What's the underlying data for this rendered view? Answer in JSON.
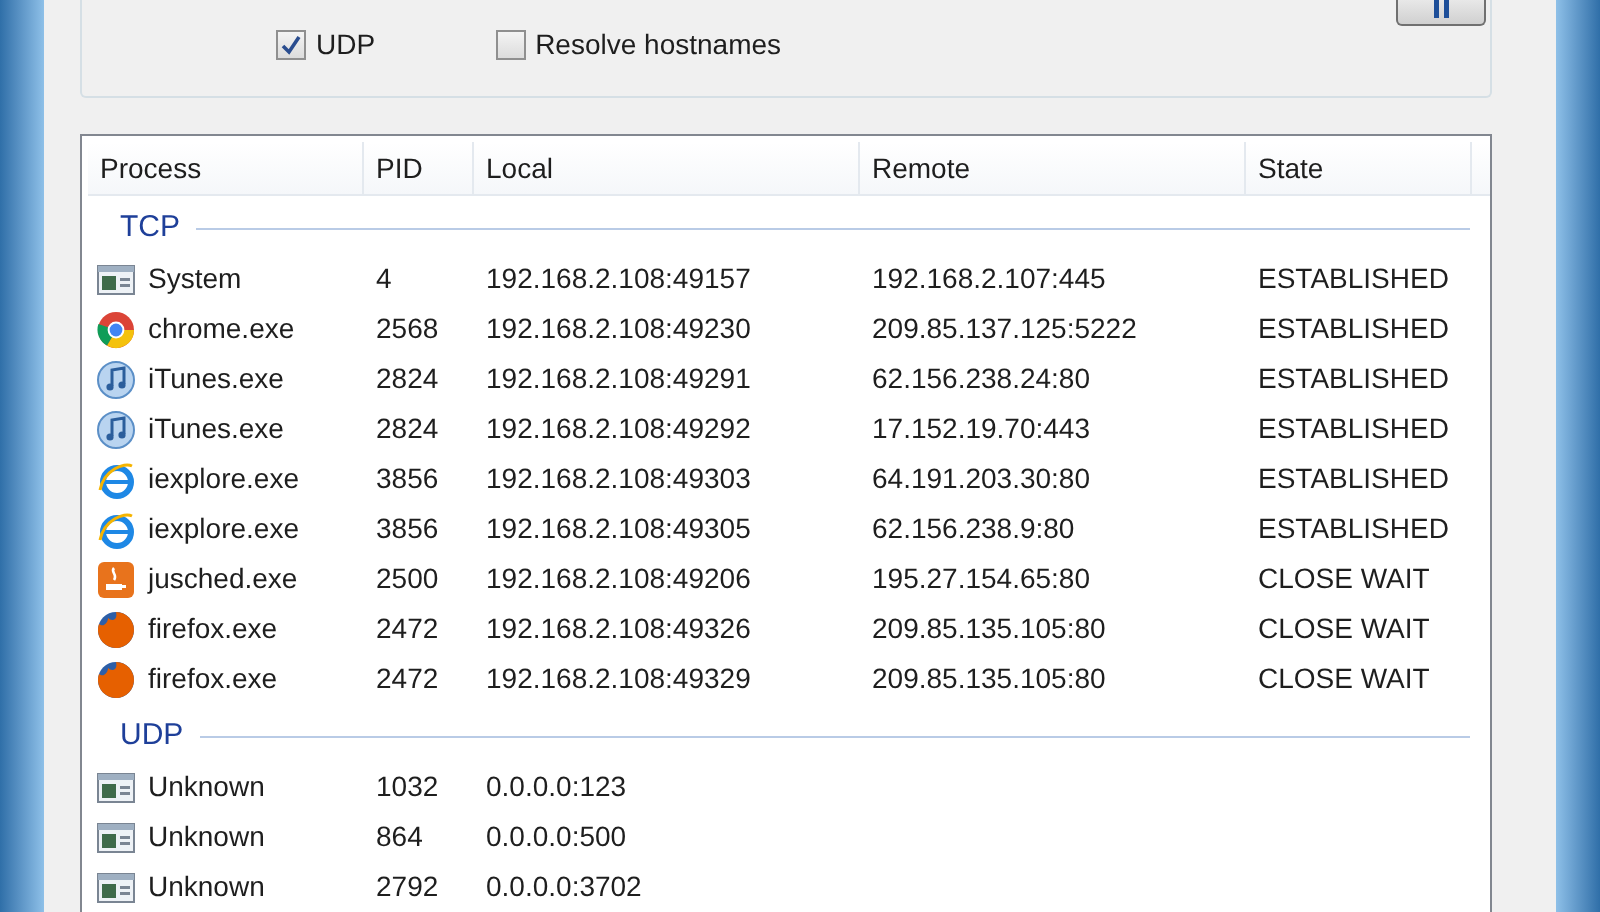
{
  "options": [
    {
      "label": "UDP",
      "checked": true
    },
    {
      "label": "Resolve hostnames",
      "checked": false
    }
  ],
  "table": {
    "columns": [
      "Process",
      "PID",
      "Local",
      "Remote",
      "State"
    ],
    "groups": [
      {
        "name": "TCP",
        "rows": [
          {
            "kind": "app",
            "process": "System",
            "pid": "4",
            "local": "192.168.2.108:49157",
            "remote": "192.168.2.107:445",
            "state": "ESTABLISHED"
          },
          {
            "kind": "chrome",
            "process": "chrome.exe",
            "pid": "2568",
            "local": "192.168.2.108:49230",
            "remote": "209.85.137.125:5222",
            "state": "ESTABLISHED"
          },
          {
            "kind": "itunes",
            "process": "iTunes.exe",
            "pid": "2824",
            "local": "192.168.2.108:49291",
            "remote": "62.156.238.24:80",
            "state": "ESTABLISHED"
          },
          {
            "kind": "itunes",
            "process": "iTunes.exe",
            "pid": "2824",
            "local": "192.168.2.108:49292",
            "remote": "17.152.19.70:443",
            "state": "ESTABLISHED"
          },
          {
            "kind": "ie",
            "process": "iexplore.exe",
            "pid": "3856",
            "local": "192.168.2.108:49303",
            "remote": "64.191.203.30:80",
            "state": "ESTABLISHED"
          },
          {
            "kind": "ie",
            "process": "iexplore.exe",
            "pid": "3856",
            "local": "192.168.2.108:49305",
            "remote": "62.156.238.9:80",
            "state": "ESTABLISHED"
          },
          {
            "kind": "java",
            "process": "jusched.exe",
            "pid": "2500",
            "local": "192.168.2.108:49206",
            "remote": "195.27.154.65:80",
            "state": "CLOSE WAIT"
          },
          {
            "kind": "firefox",
            "process": "firefox.exe",
            "pid": "2472",
            "local": "192.168.2.108:49326",
            "remote": "209.85.135.105:80",
            "state": "CLOSE WAIT"
          },
          {
            "kind": "firefox",
            "process": "firefox.exe",
            "pid": "2472",
            "local": "192.168.2.108:49329",
            "remote": "209.85.135.105:80",
            "state": "CLOSE WAIT"
          }
        ]
      },
      {
        "name": "UDP",
        "rows": [
          {
            "kind": "app",
            "process": "Unknown",
            "pid": "1032",
            "local": "0.0.0.0:123"
          },
          {
            "kind": "app",
            "process": "Unknown",
            "pid": "864",
            "local": "0.0.0.0:500"
          },
          {
            "kind": "app",
            "process": "Unknown",
            "pid": "2792",
            "local": "0.0.0.0:3702"
          }
        ]
      }
    ]
  }
}
